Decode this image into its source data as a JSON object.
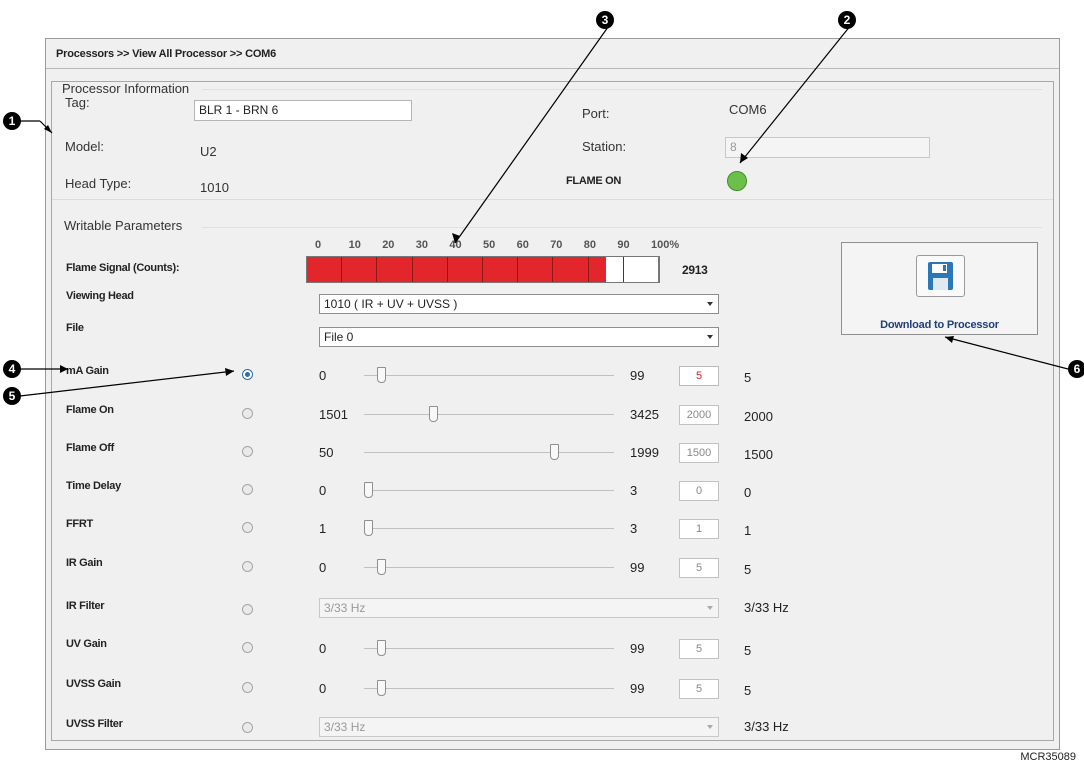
{
  "breadcrumb": "Processors >> View All Processor >> COM6",
  "processor_info": {
    "group_label": "Processor Information",
    "tag_label": "Tag:",
    "tag_value": "BLR 1 - BRN 6",
    "model_label": "Model:",
    "model_value": "U2",
    "head_type_label": "Head Type:",
    "head_type_value": "1010",
    "port_label": "Port:",
    "port_value": "COM6",
    "station_label": "Station:",
    "station_value": "8",
    "flame_status": "FLAME ON",
    "flame_led_color": "#6cc04a"
  },
  "writable": {
    "group_label": "Writable Parameters",
    "flame_signal_label": "Flame Signal (Counts):",
    "percent_ticks": [
      "0",
      "10",
      "20",
      "30",
      "40",
      "50",
      "60",
      "70",
      "80",
      "90",
      "100%"
    ],
    "flame_signal_fraction": 0.86,
    "flame_signal_value": "2913",
    "bar_color": "#e2262c",
    "viewing_head_label": "Viewing Head",
    "viewing_head_value": "1010 ( IR + UV + UVSS )",
    "file_label": "File",
    "file_value": "File 0",
    "params": [
      {
        "label": "mA Gain",
        "min": "0",
        "max": "99",
        "box": "5",
        "current": "5",
        "selected": true,
        "pos": 0.05
      },
      {
        "label": "Flame On",
        "min": "1501",
        "max": "3425",
        "box": "2000",
        "current": "2000",
        "selected": false,
        "pos": 0.26
      },
      {
        "label": "Flame Off",
        "min": "50",
        "max": "1999",
        "box": "1500",
        "current": "1500",
        "selected": false,
        "pos": 0.744
      },
      {
        "label": "Time Delay",
        "min": "0",
        "max": "3",
        "box": "0",
        "current": "0",
        "selected": false,
        "pos": 0.0
      },
      {
        "label": "FFRT",
        "min": "1",
        "max": "3",
        "box": "1",
        "current": "1",
        "selected": false,
        "pos": 0.0
      },
      {
        "label": "IR Gain",
        "min": "0",
        "max": "99",
        "box": "5",
        "current": "5",
        "selected": false,
        "pos": 0.05
      },
      {
        "label": "UV Gain",
        "min": "0",
        "max": "99",
        "box": "5",
        "current": "5",
        "selected": false,
        "pos": 0.05
      },
      {
        "label": "UVSS Gain",
        "min": "0",
        "max": "99",
        "box": "5",
        "current": "5",
        "selected": false,
        "pos": 0.05
      }
    ],
    "ir_filter": {
      "label": "IR Filter",
      "value": "3/33 Hz",
      "current": "3/33 Hz"
    },
    "uvss_filter": {
      "label": "UVSS Filter",
      "value": "3/33 Hz",
      "current": "3/33 Hz"
    }
  },
  "download_button": {
    "label": "Download to Processor",
    "icon": "floppy-disk-icon"
  },
  "callouts": [
    "1",
    "2",
    "3",
    "4",
    "5",
    "6"
  ],
  "figure_id": "MCR35089"
}
